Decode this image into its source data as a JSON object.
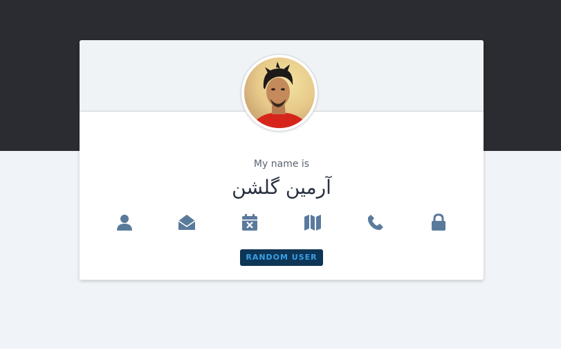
{
  "profile": {
    "label": "My name is",
    "value": "آرمین گلشن"
  },
  "icons": [
    "user-icon",
    "envelope-open-icon",
    "calendar-x-icon",
    "map-icon",
    "phone-icon",
    "lock-icon"
  ],
  "button": {
    "label": "RANDOM USER"
  },
  "colors": {
    "top_band": "#2b2c31",
    "page_background": "#f0f4f8",
    "card_header": "#eff3f6",
    "icon": "#5a7a9c",
    "button_bg": "#0d3556",
    "button_text": "#3aa0e8"
  }
}
